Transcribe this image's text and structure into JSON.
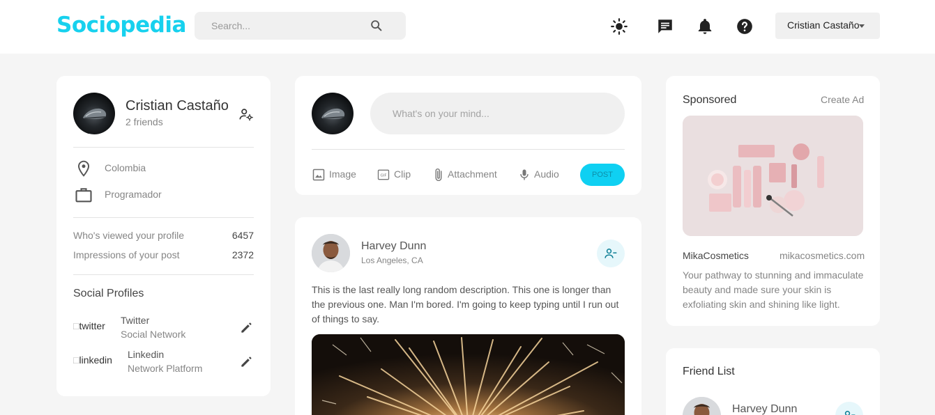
{
  "nav": {
    "logo": "Sociopedia",
    "search_placeholder": "Search...",
    "icons": [
      "search-icon",
      "light-mode-icon",
      "message-icon",
      "notification-icon",
      "help-icon"
    ],
    "user_name": "Cristian Castaño"
  },
  "profile": {
    "name": "Cristian Castaño",
    "friends": "2 friends",
    "location": "Colombia",
    "occupation": "Programador",
    "stats": [
      {
        "label": "Who's viewed your profile",
        "value": "6457"
      },
      {
        "label": "Impressions of your post",
        "value": "2372"
      }
    ],
    "social_title": "Social Profiles",
    "socials": [
      {
        "alt": "twitter",
        "name": "Twitter",
        "type": "Social Network"
      },
      {
        "alt": "linkedin",
        "name": "Linkedin",
        "type": "Network Platform"
      }
    ]
  },
  "composer": {
    "placeholder": "What's on your mind...",
    "actions": [
      "Image",
      "Clip",
      "Attachment",
      "Audio"
    ],
    "post_label": "POST"
  },
  "post": {
    "author": "Harvey Dunn",
    "location": "Los Angeles, CA",
    "description": "This is the last really long random description. This one is longer than the previous one. Man I'm bored. I'm going to keep typing until I run out of things to say."
  },
  "sponsored": {
    "title": "Sponsored",
    "create_ad": "Create Ad",
    "brand": "MikaCosmetics",
    "url": "mikacosmetics.com",
    "text": "Your pathway to stunning and immaculate beauty and made sure your skin is exfoliating skin and shining like light."
  },
  "friend_list": {
    "title": "Friend List",
    "friends": [
      {
        "name": "Harvey Dunn"
      }
    ]
  },
  "colors": {
    "accent": "#17d1ee",
    "background": "#f5f5f5",
    "card": "#ffffff"
  }
}
